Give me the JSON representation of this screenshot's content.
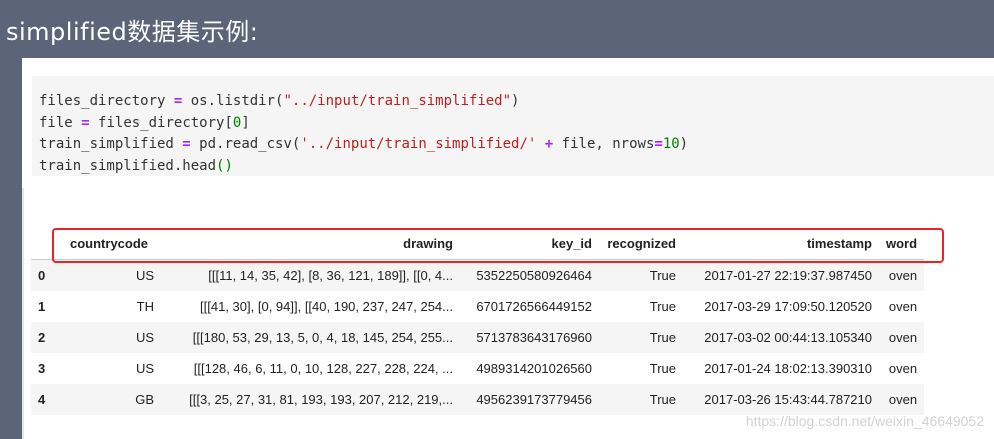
{
  "slide": {
    "title": "simplified数据集示例:"
  },
  "code": {
    "line1": {
      "var": "files_directory",
      "op": "=",
      "call": "os.listdir(",
      "arg": "\"../input/train_simplified\"",
      "close": ")"
    },
    "line2": {
      "var": "file",
      "op": "=",
      "rest_a": "files_directory[",
      "num": "0",
      "rest_b": "]"
    },
    "line3": {
      "var": "train_simplified",
      "op": "=",
      "call": "pd.read_csv(",
      "arg": "'../input/train_simplified/'",
      "plus": "+",
      "mid": "file, nrows",
      "eq": "=",
      "num": "10",
      "close": ")"
    },
    "line4": {
      "text": "train_simplified.head",
      "paren": "()"
    }
  },
  "table": {
    "columns": [
      "",
      "countrycode",
      "drawing",
      "key_id",
      "recognized",
      "timestamp",
      "word"
    ],
    "rows": [
      {
        "index": "0",
        "countrycode": "US",
        "drawing": "[[[11, 14, 35, 42], [8, 36, 121, 189]], [[0, 4...",
        "key_id": "5352250580926464",
        "recognized": "True",
        "timestamp": "2017-01-27 22:19:37.987450",
        "word": "oven"
      },
      {
        "index": "1",
        "countrycode": "TH",
        "drawing": "[[[41, 30], [0, 94]], [[40, 190, 237, 247, 254...",
        "key_id": "6701726566449152",
        "recognized": "True",
        "timestamp": "2017-03-29 17:09:50.120520",
        "word": "oven"
      },
      {
        "index": "2",
        "countrycode": "US",
        "drawing": "[[[180, 53, 29, 13, 5, 0, 4, 18, 145, 254, 255...",
        "key_id": "5713783643176960",
        "recognized": "True",
        "timestamp": "2017-03-02 00:44:13.105340",
        "word": "oven"
      },
      {
        "index": "3",
        "countrycode": "US",
        "drawing": "[[[128, 46, 6, 11, 0, 10, 128, 227, 228, 224, ...",
        "key_id": "4989314201026560",
        "recognized": "True",
        "timestamp": "2017-01-24 18:02:13.390310",
        "word": "oven"
      },
      {
        "index": "4",
        "countrycode": "GB",
        "drawing": "[[[3, 25, 27, 31, 81, 193, 193, 207, 212, 219,...",
        "key_id": "4956239173779456",
        "recognized": "True",
        "timestamp": "2017-03-26 15:43:44.787210",
        "word": "oven"
      }
    ]
  },
  "watermark": "https://blog.csdn.net/weixin_46649052",
  "colors": {
    "background": "#5b6478",
    "highlight": "#ee2222",
    "code_bg": "#f5f5f5"
  }
}
